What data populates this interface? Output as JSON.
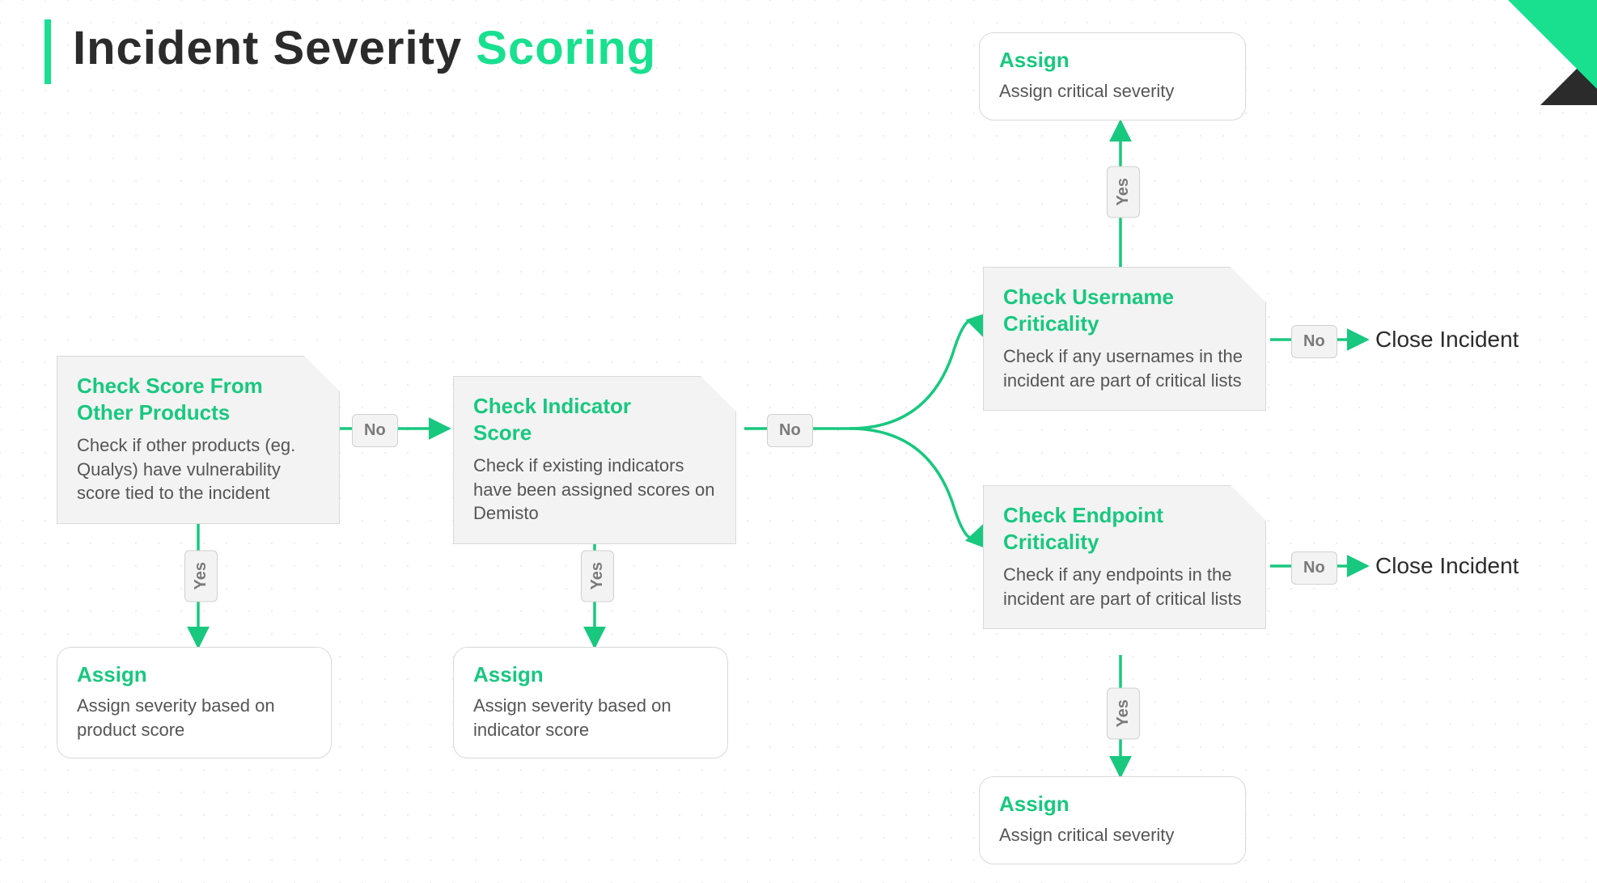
{
  "title": {
    "part1": "Incident Severity ",
    "part2": "Scoring"
  },
  "labels": {
    "yes": "Yes",
    "no": "No",
    "close": "Close Incident"
  },
  "nodes": {
    "checkProducts": {
      "title": "Check Score From Other Products",
      "desc": "Check if other products (eg. Qualys) have vulnerability score tied to the incident"
    },
    "assignProduct": {
      "title": "Assign",
      "desc": "Assign severity based on product score"
    },
    "checkIndicator": {
      "title": "Check Indicator Score",
      "desc": "Check if existing indicators have been assigned scores on Demisto"
    },
    "assignIndicator": {
      "title": "Assign",
      "desc": "Assign severity based on indicator score"
    },
    "checkUsername": {
      "title": "Check Username Criticality",
      "desc": "Check if any usernames in the incident are part of critical lists"
    },
    "assignCriticalTop": {
      "title": "Assign",
      "desc": "Assign critical severity"
    },
    "checkEndpoint": {
      "title": "Check Endpoint Criticality",
      "desc": "Check if any endpoints in the incident are part of critical lists"
    },
    "assignCriticalBottom": {
      "title": "Assign",
      "desc": "Assign critical severity"
    }
  }
}
